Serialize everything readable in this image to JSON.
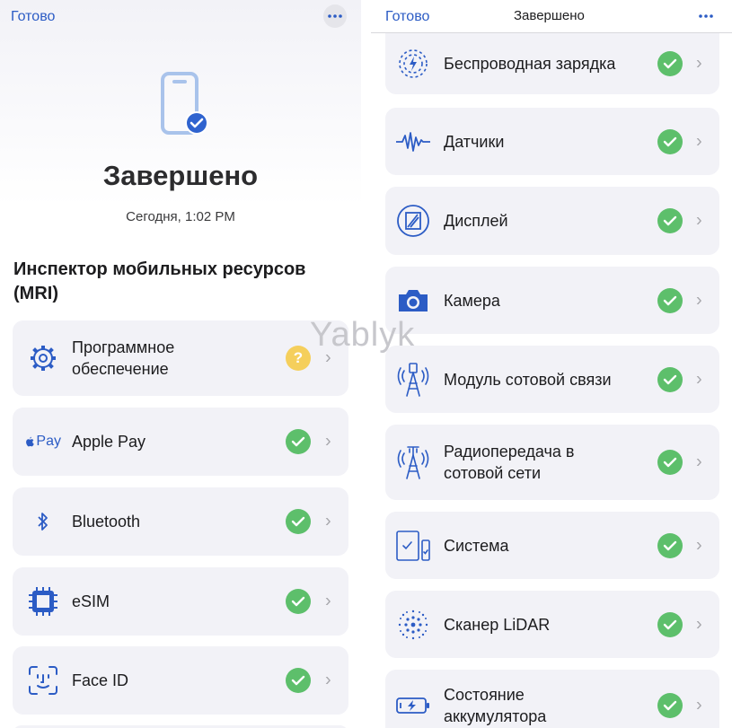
{
  "left": {
    "nav": {
      "done_label": "Готово"
    },
    "hero": {
      "title": "Завершено",
      "subtitle": "Сегодня, 1:02 PM"
    },
    "section_title": "Инспектор мобильных ресурсов (MRI)",
    "items": [
      {
        "label": "Программное обеспечение",
        "status": "?"
      },
      {
        "label": "Apple Pay",
        "icon_text": "Pay"
      },
      {
        "label": "Bluetooth"
      },
      {
        "label": "eSIM"
      },
      {
        "label": "Face ID"
      }
    ]
  },
  "right": {
    "nav": {
      "done_label": "Готово",
      "title": "Завершено"
    },
    "items": [
      {
        "label": "Беспроводная зарядка"
      },
      {
        "label": "Датчики"
      },
      {
        "label": "Дисплей"
      },
      {
        "label": "Камера"
      },
      {
        "label": "Модуль сотовой связи"
      },
      {
        "label": "Радиопередача в сотовой сети"
      },
      {
        "label": "Система"
      },
      {
        "label": "Сканер LiDAR"
      },
      {
        "label": "Состояние аккумулятора"
      }
    ]
  },
  "watermark": "Yablyk",
  "colors": {
    "accent": "#2c5cc5",
    "ok": "#5dbf6b",
    "warn": "#f5cf5c",
    "card": "#f2f2f7"
  }
}
